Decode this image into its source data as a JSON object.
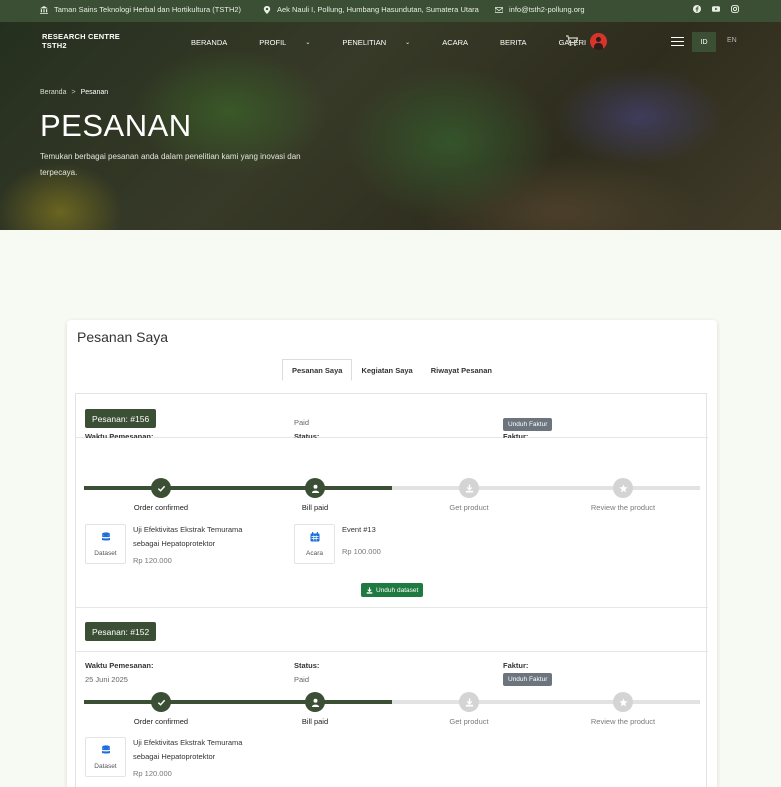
{
  "topbar": {
    "institution": "Taman Sains Teknologi Herbal dan Hortikultura (TSTH2)",
    "address": "Aek Nauli I, Pollung, Humbang Hasundutan, Sumatera Utara",
    "email": "info@tsth2-pollung.org",
    "social_icons": [
      "facebook-icon",
      "youtube-icon",
      "instagram-icon"
    ]
  },
  "nav": {
    "brand_line1": "RESEARCH CENTRE",
    "brand_line2": "TSTH2",
    "items": [
      "BERANDA",
      "PROFIL",
      "PENELITIAN",
      "ACARA",
      "BERITA",
      "GALERI"
    ],
    "lang_active": "ID",
    "lang_other": "EN"
  },
  "hero": {
    "breadcrumb_home": "Beranda",
    "breadcrumb_sep": ">",
    "breadcrumb_current": "Pesanan",
    "title": "PESANAN",
    "description": "Temukan berbagai pesanan anda dalam penelitian kami yang inovasi dan terpecaya."
  },
  "card": {
    "title": "Pesanan Saya",
    "tabs": [
      "Pesanan Saya",
      "Kegiatan Saya",
      "Riwayat Pesanan"
    ]
  },
  "labels": {
    "order_time": "Waktu Pemesanan:",
    "status": "Status:",
    "invoice": "Faktur:",
    "invoice_button": "Unduh Faktur",
    "download_dataset": "Unduh dataset"
  },
  "steps": [
    "Order confirmed",
    "Bill paid",
    "Get product",
    "Review the product"
  ],
  "orders": [
    {
      "badge": "Pesanan: #156",
      "status": "Paid",
      "progress": 0.5,
      "items": [
        {
          "type": "Dataset",
          "name": "Uji Efektivitas Ekstrak Temurama sebagai Hepatoprotektor",
          "price": "Rp 120.000"
        },
        {
          "type": "Acara",
          "name": "Event #13",
          "price": "Rp 100.000"
        }
      ]
    },
    {
      "badge": "Pesanan: #152",
      "date": "25 Juni 2025",
      "status": "Paid",
      "progress": 0.5,
      "items": [
        {
          "type": "Dataset",
          "name": "Uji Efektivitas Ekstrak Temurama sebagai Hepatoprotektor",
          "price": "Rp 120.000"
        }
      ]
    }
  ],
  "colors": {
    "primary": "#3a4f33",
    "download": "#1f7a42",
    "invoice": "#6c757d",
    "icon_blue": "#1e6fd9"
  }
}
